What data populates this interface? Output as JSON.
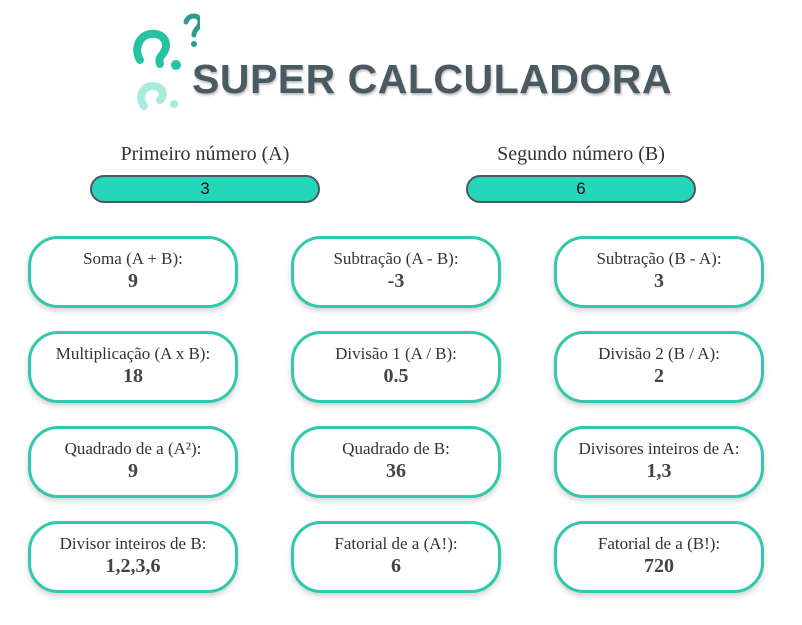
{
  "app": {
    "title": "SUPER CALCULADORA"
  },
  "colors": {
    "accent": "#26d6b8",
    "card_border": "#30c9ad",
    "title": "#4a5a63"
  },
  "inputs": {
    "a": {
      "label": "Primeiro número (A)",
      "value": "3"
    },
    "b": {
      "label": "Segundo número (B)",
      "value": "6"
    }
  },
  "results": [
    {
      "label": "Soma (A + B):",
      "value": "9"
    },
    {
      "label": "Subtração (A - B):",
      "value": "-3"
    },
    {
      "label": "Subtração (B - A):",
      "value": "3"
    },
    {
      "label": "Multiplicação (A x B):",
      "value": "18"
    },
    {
      "label": "Divisão 1 (A / B):",
      "value": "0.5"
    },
    {
      "label": "Divisão 2 (B / A):",
      "value": "2"
    },
    {
      "label": "Quadrado de a (A²):",
      "value": "9"
    },
    {
      "label": "Quadrado de B:",
      "value": "36"
    },
    {
      "label": "Divisores inteiros de A:",
      "value": "1,3"
    },
    {
      "label": "Divisor inteiros de B:",
      "value": "1,2,3,6"
    },
    {
      "label": "Fatorial de a (A!):",
      "value": "6"
    },
    {
      "label": "Fatorial de a (B!):",
      "value": "720"
    }
  ]
}
